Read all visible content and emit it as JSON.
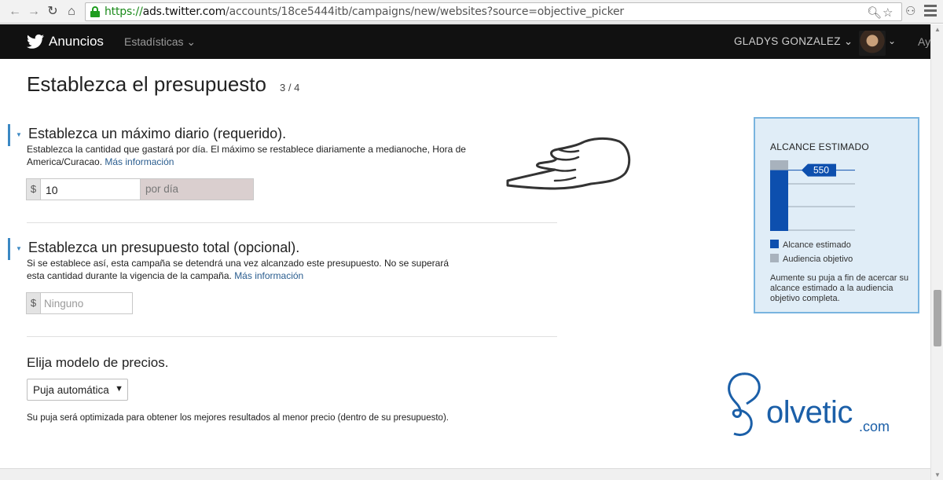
{
  "browser": {
    "url_scheme": "https://",
    "url_host": "ads.twitter.com",
    "url_path": "/accounts/18ce5444itb/campaigns/new/websites?source=objective_picker"
  },
  "nav": {
    "brand": "Anuncios",
    "stats": "Estadísticas ⌄",
    "user": "GLADYS GONZALEZ ⌄",
    "caret": "⌄",
    "more": "Ay"
  },
  "page": {
    "title": "Establezca el presupuesto",
    "step": "3 / 4"
  },
  "daily": {
    "title": "Establezca un máximo diario (requerido).",
    "desc": "Establezca la cantidad que gastará por día. El máximo se restablece diariamente a medianoche, Hora de America/Curacao.",
    "link": "Más información",
    "currency": "$",
    "value": "10",
    "suffix": "por día"
  },
  "total": {
    "title": "Establezca un presupuesto total (opcional).",
    "desc": "Si se establece así, esta campaña se detendrá una vez alcanzado este presupuesto. No se superará esta cantidad durante la vigencia de la campaña.",
    "link": "Más información",
    "currency": "$",
    "placeholder": "Ninguno"
  },
  "pricing": {
    "title": "Elija modelo de precios.",
    "selected": "Puja automática",
    "note": "Su puja será optimizada para obtener los mejores resultados al menor precio (dentro de su presupuesto)."
  },
  "reach": {
    "title": "ALCANCE ESTIMADO",
    "marker_value": "550",
    "estimated_fraction": 0.86,
    "legend_estimated": "Alcance estimado",
    "legend_audience": "Audiencia objetivo",
    "note": "Aumente su puja a fin de acercar su alcance estimado a la audiencia objetivo completa.",
    "color_estimated": "#0d4fae",
    "color_audience": "#a8b2bd"
  },
  "logo": {
    "word": "olvetic",
    "suffix": ".com"
  }
}
